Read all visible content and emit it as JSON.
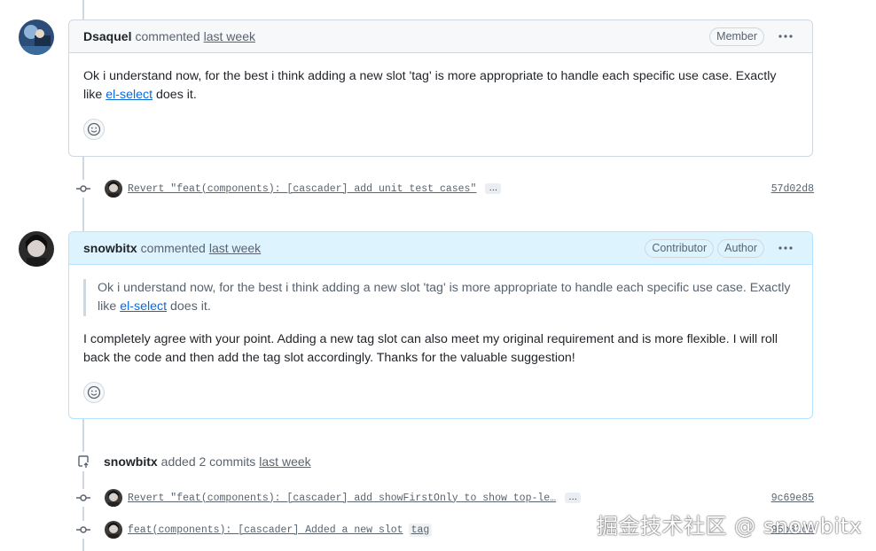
{
  "comments": [
    {
      "author": "Dsaquel",
      "action": "commented",
      "time": "last week",
      "badges": [
        "Member"
      ],
      "body_prefix": "Ok i understand now, for the best i think adding a new slot 'tag' is more appropriate to handle each specific use case. Exactly like ",
      "body_link": "el-select",
      "body_suffix": " does it."
    },
    {
      "author": "snowbitx",
      "action": "commented",
      "time": "last week",
      "badges": [
        "Contributor",
        "Author"
      ],
      "quote_prefix": "Ok i understand now, for the best i think adding a new slot 'tag' is more appropriate to handle each specific use case. Exactly like ",
      "quote_link": "el-select",
      "quote_suffix": " does it.",
      "body": "I completely agree with your point. Adding a new tag slot can also meet my original requirement and is more flexible. I will roll back the code and then add the tag slot accordingly. Thanks for the valuable suggestion!"
    }
  ],
  "commits": [
    {
      "message": "Revert \"feat(components): [cascader] add unit test cases\"",
      "more": "…",
      "sha": "57d02d8"
    },
    {
      "message": "Revert \"feat(components): [cascader] add showFirstOnly to show top-le…",
      "more": "…",
      "sha": "9c69e85"
    },
    {
      "message": "feat(components): [cascader] Added a new slot ",
      "code": "tag",
      "sha": "95b82d6"
    }
  ],
  "event": {
    "author": "snowbitx",
    "action": "added 2 commits",
    "time": "last week"
  },
  "watermark": "掘金技术社区 @ snowbitx",
  "colors": {
    "link": "#0969da",
    "muted": "#59636e",
    "highlight_header": "#ddf4ff",
    "border": "#d0d7de"
  }
}
